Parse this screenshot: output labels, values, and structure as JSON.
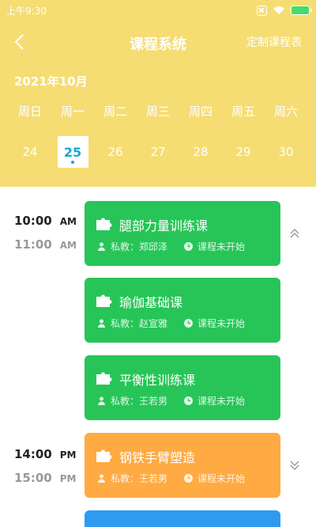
{
  "status_bar": {
    "time": "上午9:30"
  },
  "nav": {
    "title": "课程系统",
    "action": "定制课程表"
  },
  "calendar": {
    "month": "2021年10月",
    "weekdays": [
      "周日",
      "周一",
      "周二",
      "周三",
      "周四",
      "周五",
      "周六"
    ],
    "dates": [
      "24",
      "25",
      "26",
      "27",
      "28",
      "29",
      "30"
    ],
    "selected": "25"
  },
  "slots": [
    {
      "start": "10:00",
      "start_ampm": "AM",
      "end": "11:00",
      "end_ampm": "AM"
    },
    {
      "start": "14:00",
      "start_ampm": "PM",
      "end": "15:00",
      "end_ampm": "PM"
    }
  ],
  "courses": [
    {
      "title": "腿部力量训练课",
      "teacher": "私教：郑邱泽",
      "status": "课程未开始",
      "color": "#27c558"
    },
    {
      "title": "瑜伽基础课",
      "teacher": "私教：赵宣雅",
      "status": "课程未开始",
      "color": "#27c558"
    },
    {
      "title": "平衡性训练课",
      "teacher": "私教：王若男",
      "status": "课程未开始",
      "color": "#27c558"
    },
    {
      "title": "钢铁手臂塑造",
      "teacher": "私教：王若男",
      "status": "课程未开始",
      "color": "#ffaa42"
    },
    {
      "title": "",
      "teacher": "",
      "status": "",
      "color": "#2d9bf0"
    }
  ],
  "colors": {
    "header_bg": "#f5dd74",
    "accent": "#14a9d3"
  }
}
